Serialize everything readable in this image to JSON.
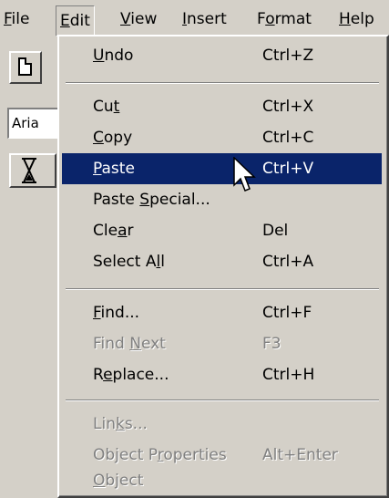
{
  "menubar": {
    "items": [
      {
        "text": "File",
        "mnemonic": "F"
      },
      {
        "text": "Edit",
        "mnemonic": "E"
      },
      {
        "text": "View",
        "mnemonic": "V"
      },
      {
        "text": "Insert",
        "mnemonic": "I"
      },
      {
        "text": "Format",
        "mnemonic": "o"
      },
      {
        "text": "Help",
        "mnemonic": "H"
      }
    ]
  },
  "toolbar": {
    "font_name": "Aria"
  },
  "edit_menu": {
    "items": [
      {
        "before": "",
        "mnemonic": "U",
        "after": "ndo",
        "shortcut": "Ctrl+Z",
        "state": "enabled"
      },
      {
        "before": "Cu",
        "mnemonic": "t",
        "after": "",
        "shortcut": "Ctrl+X",
        "state": "enabled"
      },
      {
        "before": "",
        "mnemonic": "C",
        "after": "opy",
        "shortcut": "Ctrl+C",
        "state": "enabled"
      },
      {
        "before": "",
        "mnemonic": "P",
        "after": "aste",
        "shortcut": "Ctrl+V",
        "state": "selected"
      },
      {
        "before": "Paste ",
        "mnemonic": "S",
        "after": "pecial...",
        "shortcut": "",
        "state": "enabled"
      },
      {
        "before": "Cle",
        "mnemonic": "a",
        "after": "r",
        "shortcut": "Del",
        "state": "enabled"
      },
      {
        "before": "Select A",
        "mnemonic": "l",
        "after": "l",
        "shortcut": "Ctrl+A",
        "state": "enabled"
      },
      {
        "before": "",
        "mnemonic": "F",
        "after": "ind...",
        "shortcut": "Ctrl+F",
        "state": "enabled"
      },
      {
        "before": "Find ",
        "mnemonic": "N",
        "after": "ext",
        "shortcut": "F3",
        "state": "disabled"
      },
      {
        "before": "R",
        "mnemonic": "e",
        "after": "place...",
        "shortcut": "Ctrl+H",
        "state": "enabled"
      },
      {
        "before": "Lin",
        "mnemonic": "k",
        "after": "s...",
        "shortcut": "",
        "state": "disabled"
      },
      {
        "before": "Object P",
        "mnemonic": "r",
        "after": "operties",
        "shortcut": "Alt+Enter",
        "state": "disabled"
      },
      {
        "before": "",
        "mnemonic": "O",
        "after": "bject",
        "shortcut": "",
        "state": "disabled"
      }
    ]
  },
  "colors": {
    "face": "#d4d0c8",
    "highlight": "#0a246a",
    "disabled_text": "#808080"
  }
}
